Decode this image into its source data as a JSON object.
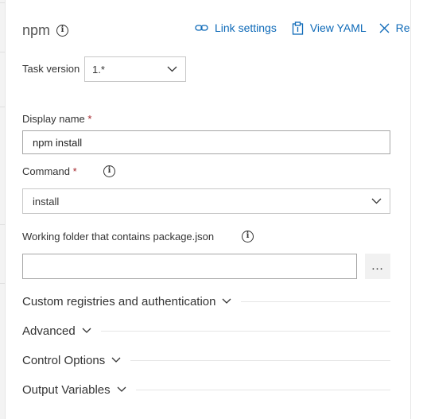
{
  "task": {
    "title": "npm"
  },
  "toolbar": {
    "link_settings_label": "Link settings",
    "view_yaml_label": "View YAML",
    "remove_label": "Re"
  },
  "fields": {
    "task_version": {
      "label": "Task version",
      "value": "1.*"
    },
    "display_name": {
      "label": "Display name",
      "required_mark": "*",
      "value": "npm install"
    },
    "command": {
      "label": "Command",
      "required_mark": "*",
      "value": "install"
    },
    "working_folder": {
      "label": "Working folder that contains package.json",
      "value": "",
      "browse_label": "…"
    }
  },
  "sections": [
    {
      "title": "Custom registries and authentication"
    },
    {
      "title": "Advanced"
    },
    {
      "title": "Control Options"
    },
    {
      "title": "Output Variables"
    }
  ],
  "colors": {
    "accent": "#0e6ab8",
    "required": "#a4262c",
    "text": "#333333",
    "border": "#c8c8c8"
  },
  "icons": {
    "info": "info-icon",
    "link": "link-icon",
    "yaml": "clipboard-icon",
    "remove": "close-icon",
    "dropdown": "chevron-down-icon"
  }
}
